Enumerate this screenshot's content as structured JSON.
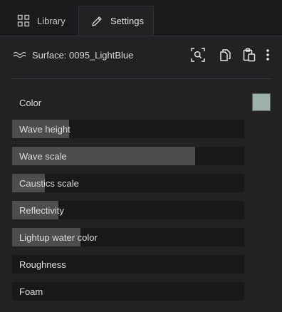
{
  "tabs": [
    {
      "label": "Library",
      "icon": "grid-icon"
    },
    {
      "label": "Settings",
      "icon": "pencil-icon",
      "active": true
    }
  ],
  "surface": {
    "label": "Surface: 0095_LightBlue",
    "icon": "wave-icon"
  },
  "toolbar": {
    "search_icon": "search-frame-icon",
    "copy_icon": "copy-icon",
    "paste_icon": "paste-icon",
    "more_icon": "more-vertical-icon"
  },
  "color": {
    "label": "Color",
    "swatch": "#9cb1a9"
  },
  "sliders": [
    {
      "label": "Wave height",
      "value": 0.245
    },
    {
      "label": "Wave scale",
      "value": 0.787
    },
    {
      "label": "Caustics scale",
      "value": 0.141
    },
    {
      "label": "Reflectivity",
      "value": 0.199
    },
    {
      "label": "Lightup water color",
      "value": 0.294
    },
    {
      "label": "Roughness",
      "value": 0
    },
    {
      "label": "Foam",
      "value": 0
    }
  ],
  "colors": {
    "background": "#1b1b1d",
    "panel": "#222224",
    "slider_track": "#19191b",
    "slider_fill": "#4d4d50"
  }
}
